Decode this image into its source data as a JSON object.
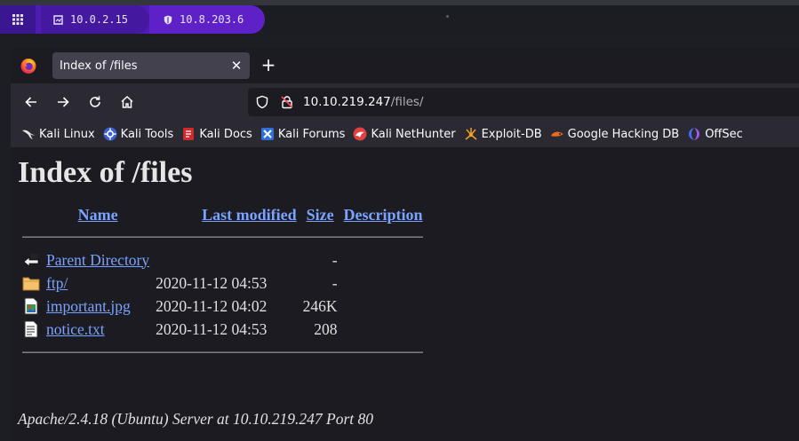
{
  "panel": {
    "vpn_ips": [
      {
        "label": "10.0.2.15",
        "icon": "network-icon"
      },
      {
        "label": "10.8.203.6",
        "icon": "shield-icon"
      }
    ],
    "accent": "#4f1bb3"
  },
  "browser": {
    "tab_title": "Index of /files",
    "url_host": "10.10.219.247",
    "url_path": "/files/",
    "bookmarks": [
      {
        "label": "Kali Linux",
        "icon": "kali-dragon-icon"
      },
      {
        "label": "Kali Tools",
        "icon": "kali-tools-icon"
      },
      {
        "label": "Kali Docs",
        "icon": "kali-docs-icon"
      },
      {
        "label": "Kali Forums",
        "icon": "kali-forums-icon"
      },
      {
        "label": "Kali NetHunter",
        "icon": "nethunter-icon"
      },
      {
        "label": "Exploit-DB",
        "icon": "exploit-db-icon"
      },
      {
        "label": "Google Hacking DB",
        "icon": "ghdb-icon"
      },
      {
        "label": "OffSec",
        "icon": "offsec-icon"
      }
    ]
  },
  "page": {
    "title": "Index of /files",
    "columns": {
      "name": "Name",
      "modified": "Last modified",
      "size": "Size",
      "description": "Description"
    },
    "rows": [
      {
        "name": "Parent Directory",
        "modified": "",
        "size": "-",
        "icon": "back-arrow-icon"
      },
      {
        "name": "ftp/",
        "modified": "2020-11-12 04:53",
        "size": "-",
        "icon": "folder-icon"
      },
      {
        "name": "important.jpg",
        "modified": "2020-11-12 04:02",
        "size": "246K",
        "icon": "image-file-icon"
      },
      {
        "name": "notice.txt",
        "modified": "2020-11-12 04:53",
        "size": "208",
        "icon": "text-file-icon"
      }
    ],
    "address": "Apache/2.4.18 (Ubuntu) Server at 10.10.219.247 Port 80"
  }
}
